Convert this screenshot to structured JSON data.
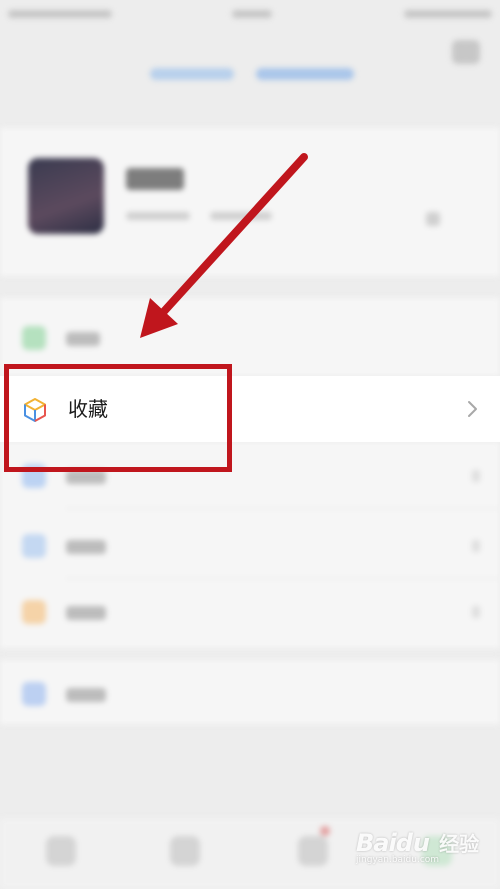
{
  "colors": {
    "background": "#ededed",
    "annotation_red": "#c0161d",
    "row_background": "#ffffff"
  },
  "favorites_row": {
    "label": "收藏",
    "icon": "favorites-cube-icon",
    "chevron_icon": "chevron-right-icon"
  },
  "watermark": {
    "logo": "Bai",
    "logo_suffix": "du",
    "text": "经验",
    "sub": "jingyan.baidu.com"
  }
}
